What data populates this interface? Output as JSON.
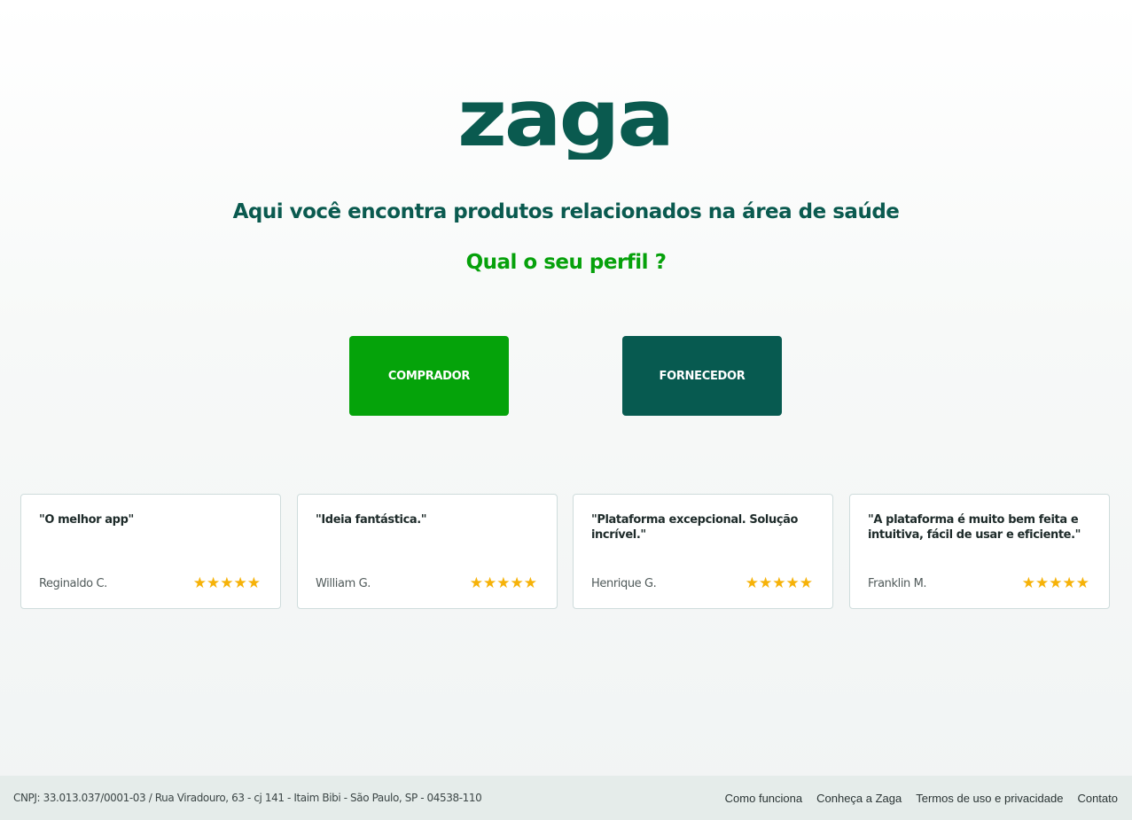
{
  "brand": {
    "logo_text": "zaga",
    "primary_color": "#0a5a4f",
    "accent_color": "#06a10b"
  },
  "hero": {
    "headline": "Aqui você encontra produtos relacionados na área de saúde",
    "question": "Qual o seu perfil ?"
  },
  "profile_buttons": {
    "buyer_label": "COMPRADOR",
    "supplier_label": "FORNECEDOR"
  },
  "testimonials": [
    {
      "quote": "\"O melhor app\"",
      "author": "Reginaldo C.",
      "rating": 5,
      "stars": "★★★★★"
    },
    {
      "quote": "\"Ideia fantástica.\"",
      "author": "William G.",
      "rating": 5,
      "stars": "★★★★★"
    },
    {
      "quote": "\"Plataforma excepcional. Solução incrível.\"",
      "author": "Henrique G.",
      "rating": 5,
      "stars": "★★★★★"
    },
    {
      "quote": "\"A plataforma é muito bem feita e intuitiva, fácil de usar e eficiente.\"",
      "author": "Franklin M.",
      "rating": 5,
      "stars": "★★★★★"
    }
  ],
  "footer": {
    "company_info": "CNPJ: 33.013.037/0001-03 / Rua Viradouro, 63 - cj 141 - Itaim Bibi - São Paulo, SP - 04538-110",
    "links": [
      "Como funciona",
      "Conheça a Zaga",
      "Termos de uso e privacidade",
      "Contato"
    ]
  }
}
